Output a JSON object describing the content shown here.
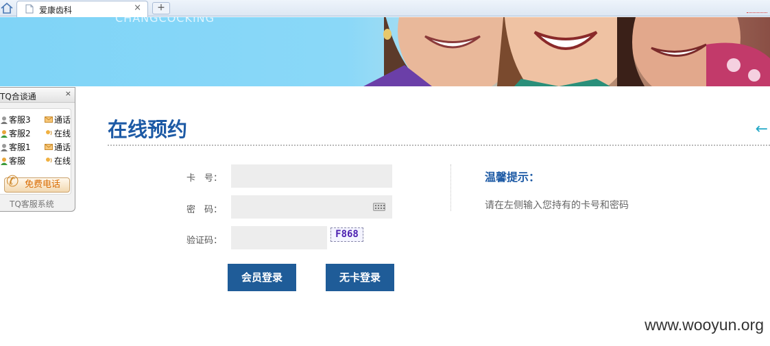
{
  "browser": {
    "tab_title": "爱康齿科",
    "tab_close": "×",
    "new_tab": "+"
  },
  "banner": {
    "partial_text": "CHANGCOCKING"
  },
  "tq_widget": {
    "title": "TQ合谈通",
    "close": "×",
    "agents": [
      {
        "name": "客服3",
        "status": "通话",
        "status_icon": "envelope-icon"
      },
      {
        "name": "客服2",
        "status": "在线",
        "status_icon": "online-icon"
      },
      {
        "name": "客服1",
        "status": "通话",
        "status_icon": "envelope-icon"
      },
      {
        "name": "客服",
        "status": "在线",
        "status_icon": "online-icon"
      }
    ],
    "phone_button": "免费电话",
    "footer": "TQ客服系统"
  },
  "page": {
    "title": "在线预约",
    "back_icon": "←"
  },
  "form": {
    "card_label": "卡　号：",
    "password_label": "密　码：",
    "captcha_label": "验证码：",
    "card_value": "",
    "password_value": "",
    "captcha_value": "",
    "captcha_image_text": "F868",
    "member_login": "会员登录",
    "no_card_login": "无卡登录"
  },
  "tips": {
    "title": "温馨提示：",
    "text": "请在左侧输入您持有的卡号和密码"
  },
  "watermark": "www.wooyun.org",
  "colors": {
    "accent_blue": "#1d5aa5",
    "button_blue": "#1f5c98",
    "field_bg": "#ededed",
    "back_arrow": "#22a8c7"
  }
}
